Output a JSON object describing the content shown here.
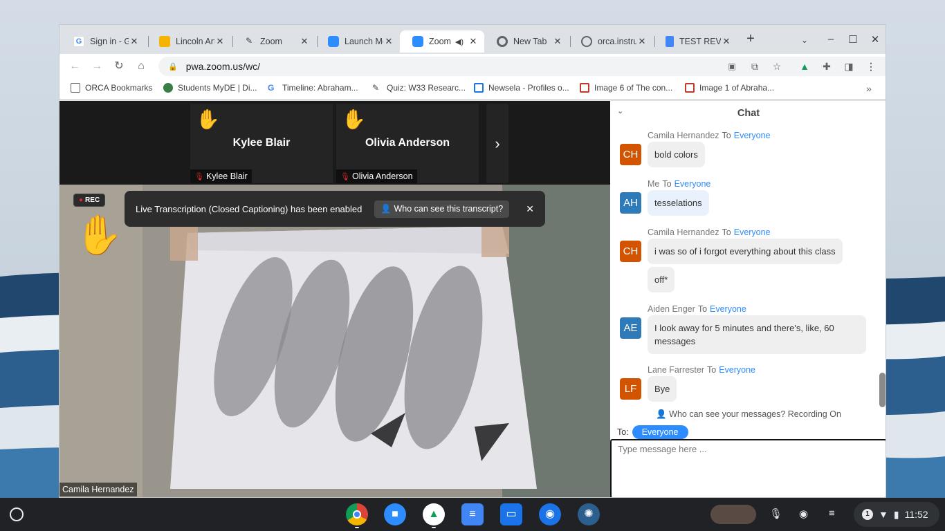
{
  "browser": {
    "tabs": [
      {
        "title": "Sign in - Go",
        "icon_color": "#4285f4",
        "icon": "google-icon",
        "active": false
      },
      {
        "title": "Lincoln Art",
        "icon_color": "#f4b400",
        "icon": "slides-icon",
        "active": false
      },
      {
        "title": "Zoom",
        "icon_color": "#3c4043",
        "icon": "custom-icon",
        "active": false
      },
      {
        "title": "Launch Me",
        "icon_color": "#2d8cff",
        "icon": "zoom-icon",
        "active": false
      },
      {
        "title": "Zoom",
        "icon_color": "#2d8cff",
        "icon": "zoom-icon",
        "active": true
      },
      {
        "title": "New Tab",
        "icon_color": "#5f6368",
        "icon": "chrome-icon",
        "active": false
      },
      {
        "title": "orca.instru",
        "icon_color": "#5f6368",
        "icon": "globe-icon",
        "active": false
      },
      {
        "title": "TEST REVI",
        "icon_color": "#4285f4",
        "icon": "docs-icon",
        "active": false
      }
    ],
    "url": "pwa.zoom.us/wc/",
    "bookmarks": [
      {
        "label": "ORCA Bookmarks",
        "icon_color": "#5f6368"
      },
      {
        "label": "Students MyDE | Di...",
        "icon_color": "#3a7d44"
      },
      {
        "label": "Timeline: Abraham...",
        "icon_color": "#4285f4"
      },
      {
        "label": "Quiz: W33 Researc...",
        "icon_color": "#3c4043"
      },
      {
        "label": "Newsela - Profiles o...",
        "icon_color": "#1a73e8"
      },
      {
        "label": "Image 6 of The con...",
        "icon_color": "#c0392b"
      },
      {
        "label": "Image 1 of Abraha...",
        "icon_color": "#c0392b"
      }
    ]
  },
  "gallery": {
    "tiles": [
      {
        "name": "Kylee Blair",
        "footer": "Kylee Blair"
      },
      {
        "name": "Olivia Anderson",
        "footer": "Olivia Anderson"
      }
    ]
  },
  "video": {
    "rec_label": "REC",
    "banner_text": "Live Transcription (Closed Captioning) has been enabled",
    "banner_button": "Who can see this transcript?",
    "speaker_name": "Camila Hernandez"
  },
  "chat": {
    "title": "Chat",
    "to_word": "To",
    "messages": [
      {
        "sender": "Camila Hernandez",
        "to": "Everyone",
        "initials": "CH",
        "avatar_color": "#d35400",
        "texts": [
          "bold colors"
        ]
      },
      {
        "sender": "Me",
        "to": "Everyone",
        "initials": "AH",
        "avatar_color": "#2f7ab8",
        "texts": [
          "tesselations"
        ]
      },
      {
        "sender": "Camila Hernandez",
        "to": "Everyone",
        "initials": "CH",
        "avatar_color": "#d35400",
        "texts": [
          "i was so of i forgot everything about this class",
          "off*"
        ]
      },
      {
        "sender": "Aiden Enger",
        "to": "Everyone",
        "initials": "AE",
        "avatar_color": "#2f7ab8",
        "texts": [
          "I look away for 5 minutes and there's, like, 60 messages"
        ]
      },
      {
        "sender": "Lane Farrester",
        "to": "Everyone",
        "initials": "LF",
        "avatar_color": "#d35400",
        "texts": [
          "Bye"
        ]
      }
    ],
    "who_can_see": "Who can see your messages? Recording On",
    "to_label": "To:",
    "to_target": "Everyone",
    "input_placeholder": "Type message here ..."
  },
  "shelf": {
    "time": "11:52",
    "notification_count": "1"
  }
}
